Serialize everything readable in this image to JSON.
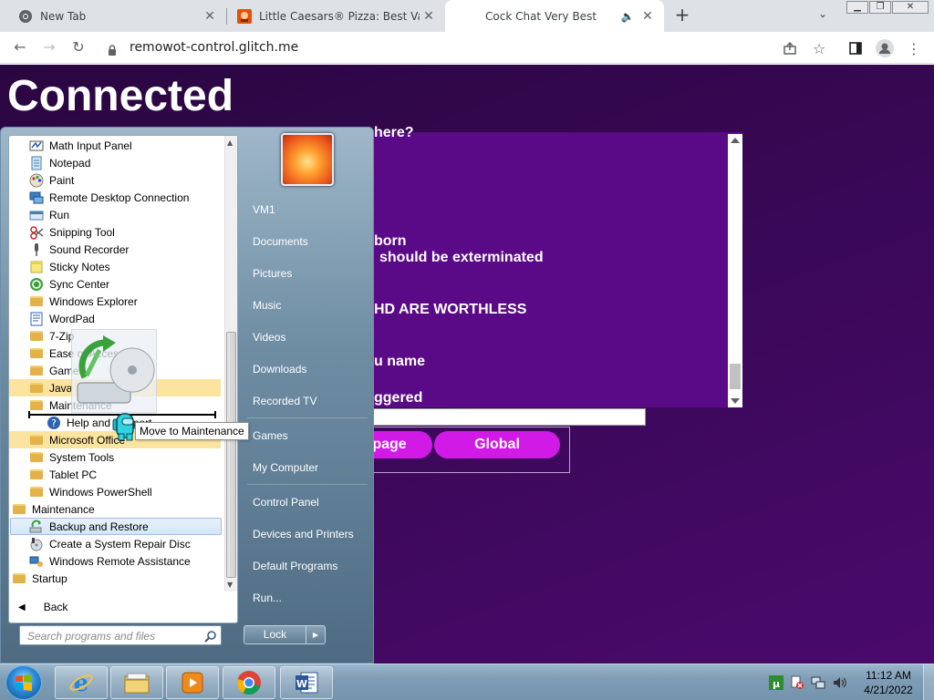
{
  "browser": {
    "tabs": [
      {
        "title": "New Tab",
        "icon": "chrome-icon",
        "active": false
      },
      {
        "title": "Little Caesars® Pizza: Best Value",
        "icon": "little-caesars-icon",
        "active": false
      },
      {
        "title": "Cock Chat Very Best",
        "icon": "moon-icon",
        "active": true
      }
    ],
    "url": "remowot-control.glitch.me"
  },
  "page": {
    "title": "Connected",
    "messages": [
      "here?",
      "born",
      "should be exterminated",
      "HD ARE WORTHLESS",
      "u name",
      "ggered"
    ],
    "buttons": {
      "page": "page",
      "global": "Global"
    }
  },
  "start_menu": {
    "programs": [
      {
        "label": "Math Input Panel",
        "icon": "math-input-icon"
      },
      {
        "label": "Notepad",
        "icon": "notepad-icon"
      },
      {
        "label": "Paint",
        "icon": "paint-icon"
      },
      {
        "label": "Remote Desktop Connection",
        "icon": "remote-desktop-icon"
      },
      {
        "label": "Run",
        "icon": "run-icon"
      },
      {
        "label": "Snipping Tool",
        "icon": "scissors-icon"
      },
      {
        "label": "Sound Recorder",
        "icon": "microphone-icon"
      },
      {
        "label": "Sticky Notes",
        "icon": "sticky-notes-icon"
      },
      {
        "label": "Sync Center",
        "icon": "sync-icon"
      },
      {
        "label": "Windows Explorer",
        "icon": "folder-icon"
      },
      {
        "label": "WordPad",
        "icon": "wordpad-icon"
      },
      {
        "label": "7-Zip",
        "icon": "folder-icon"
      },
      {
        "label": "Ease of Access",
        "icon": "folder-icon"
      },
      {
        "label": "Games",
        "icon": "folder-icon"
      },
      {
        "label": "Java",
        "icon": "folder-icon"
      },
      {
        "label": "Maintenance",
        "icon": "folder-icon"
      },
      {
        "label": "Help and Support",
        "icon": "help-icon"
      },
      {
        "label": "Microsoft Office",
        "icon": "folder-icon"
      },
      {
        "label": "System Tools",
        "icon": "folder-icon"
      },
      {
        "label": "Tablet PC",
        "icon": "folder-icon"
      },
      {
        "label": "Windows PowerShell",
        "icon": "folder-icon"
      },
      {
        "label": "Maintenance",
        "icon": "folder-icon"
      },
      {
        "label": "Backup and Restore",
        "icon": "backup-icon"
      },
      {
        "label": "Create a System Repair Disc",
        "icon": "repair-disc-icon"
      },
      {
        "label": "Windows Remote Assistance",
        "icon": "remote-assistance-icon"
      },
      {
        "label": "Startup",
        "icon": "folder-icon"
      }
    ],
    "back_label": "Back",
    "search_placeholder": "Search programs and files",
    "right_links": [
      "VM1",
      "Documents",
      "Pictures",
      "Music",
      "Videos",
      "Downloads",
      "Recorded TV",
      "Games",
      "My Computer",
      "Control Panel",
      "Devices and Printers",
      "Default Programs",
      "Run..."
    ],
    "lock_label": "Lock",
    "drag_tooltip": "Move to Maintenance"
  },
  "taskbar": {
    "apps": [
      "internet-explorer-icon",
      "windows-explorer-icon",
      "media-player-icon",
      "chrome-icon",
      "word-icon"
    ],
    "time": "11:12 AM",
    "date": "4/21/2022"
  },
  "colors": {
    "page_bg": "#3a0858",
    "pill": "#d11ae6",
    "accent": "#1a73e8"
  }
}
